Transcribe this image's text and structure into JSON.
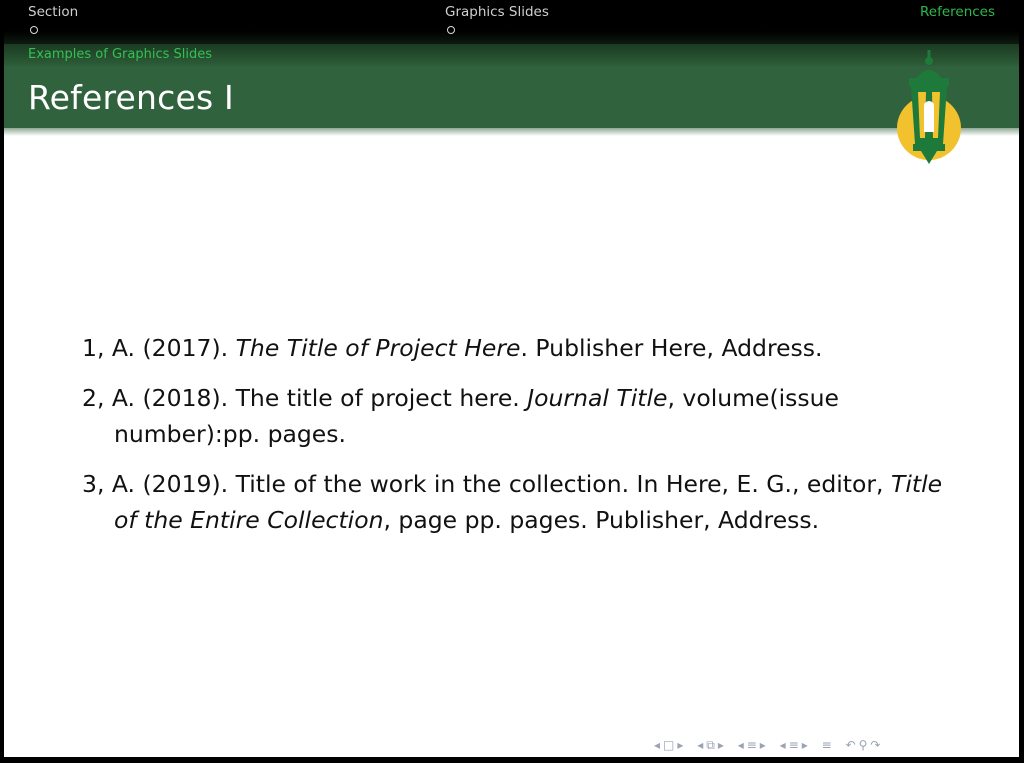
{
  "navbar": {
    "items": [
      {
        "label": "Section",
        "active": false
      },
      {
        "label": "Graphics Slides",
        "active": false
      },
      {
        "label": "References",
        "active": true
      }
    ]
  },
  "subsection": "Examples of Graphics Slides",
  "frame_title": "References I",
  "references": [
    {
      "prefix": "1, A. (2017). ",
      "italic": "The Title of Project Here",
      "suffix": ". Publisher Here, Address."
    },
    {
      "prefix": "2, A. (2018). The title of project here. ",
      "italic": "Journal Title",
      "suffix": ", volume(issue number):pp. pages."
    },
    {
      "prefix": "3, A. (2019). Title of the work in the collection. In Here, E. G., editor, ",
      "italic": "Title of the Entire Collection",
      "suffix": ", page pp. pages. Publisher, Address."
    }
  ],
  "colors": {
    "title_bar": "#30633d",
    "accent_green": "#2db84c",
    "logo_gold": "#f2c12e",
    "logo_green": "#1e7a3a"
  },
  "icons": [
    "lantern-logo",
    "nav-frame-icon",
    "nav-subsection-icon",
    "nav-section-icon",
    "nav-presentation-icon",
    "search-icon"
  ]
}
